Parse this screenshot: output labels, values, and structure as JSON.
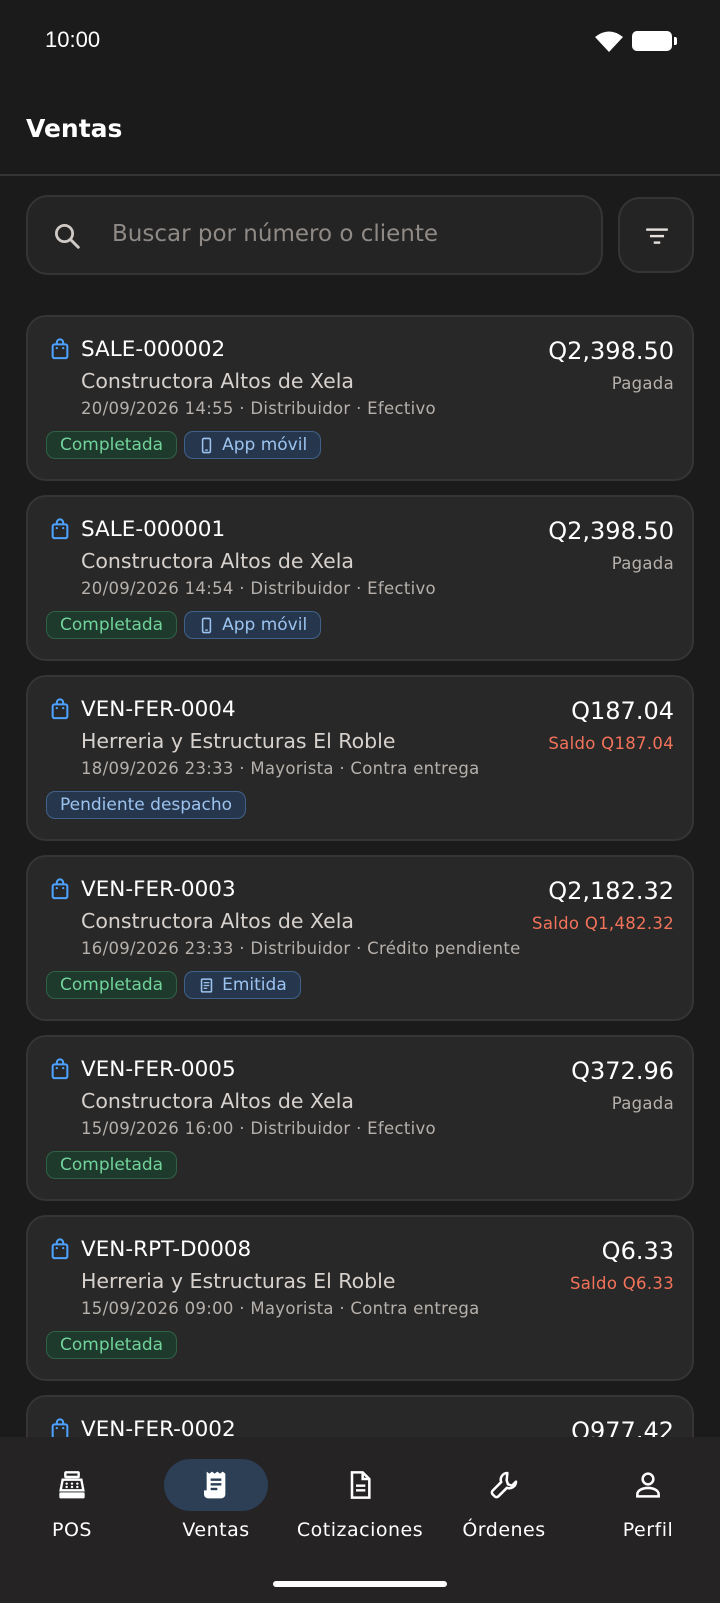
{
  "status_bar": {
    "time": "10:00"
  },
  "app_bar": {
    "title": "Ventas"
  },
  "search": {
    "placeholder": "Buscar por número o cliente"
  },
  "colors": {
    "accent": "#4da3ff",
    "paid": "#b5b0ab",
    "balance_due": "#f2735a",
    "chip_green": "#72d29b",
    "chip_blue": "#9cc3ef"
  },
  "sales": [
    {
      "number": "SALE-000002",
      "customer": "Constructora Altos de Xela",
      "meta": "20/09/2026 14:55 · Distribuidor · Efectivo",
      "amount": "Q2,398.50",
      "balance": "Pagada",
      "balance_due": false,
      "chips": [
        {
          "label": "Completada",
          "style": "green",
          "icon": ""
        },
        {
          "label": "App móvil",
          "style": "blue",
          "icon": "phone-icon"
        }
      ]
    },
    {
      "number": "SALE-000001",
      "customer": "Constructora Altos de Xela",
      "meta": "20/09/2026 14:54 · Distribuidor · Efectivo",
      "amount": "Q2,398.50",
      "balance": "Pagada",
      "balance_due": false,
      "chips": [
        {
          "label": "Completada",
          "style": "green",
          "icon": ""
        },
        {
          "label": "App móvil",
          "style": "blue",
          "icon": "phone-icon"
        }
      ]
    },
    {
      "number": "VEN-FER-0004",
      "customer": "Herreria y Estructuras El Roble",
      "meta": "18/09/2026 23:33 · Mayorista · Contra entrega",
      "amount": "Q187.04",
      "balance": "Saldo Q187.04",
      "balance_due": true,
      "chips": [
        {
          "label": "Pendiente despacho",
          "style": "blue",
          "icon": ""
        }
      ]
    },
    {
      "number": "VEN-FER-0003",
      "customer": "Constructora Altos de Xela",
      "meta": "16/09/2026 23:33 · Distribuidor · Crédito pendiente",
      "amount": "Q2,182.32",
      "balance": "Saldo Q1,482.32",
      "balance_due": true,
      "chips": [
        {
          "label": "Completada",
          "style": "green",
          "icon": ""
        },
        {
          "label": "Emitida",
          "style": "blue",
          "icon": "receipt-icon"
        }
      ]
    },
    {
      "number": "VEN-FER-0005",
      "customer": "Constructora Altos de Xela",
      "meta": "15/09/2026 16:00 · Distribuidor · Efectivo",
      "amount": "Q372.96",
      "balance": "Pagada",
      "balance_due": false,
      "chips": [
        {
          "label": "Completada",
          "style": "green",
          "icon": ""
        }
      ]
    },
    {
      "number": "VEN-RPT-D0008",
      "customer": "Herreria y Estructuras El Roble",
      "meta": "15/09/2026 09:00 · Mayorista · Contra entrega",
      "amount": "Q6.33",
      "balance": "Saldo Q6.33",
      "balance_due": true,
      "chips": [
        {
          "label": "Completada",
          "style": "green",
          "icon": ""
        }
      ]
    },
    {
      "number": "VEN-FER-0002",
      "customer": "",
      "meta": "",
      "amount": "Q977.42",
      "balance": "",
      "balance_due": false,
      "chips": []
    }
  ],
  "bottom_nav": [
    {
      "label": "POS",
      "icon": "cash-register-icon",
      "active": false
    },
    {
      "label": "Ventas",
      "icon": "receipt-long-icon",
      "active": true
    },
    {
      "label": "Cotizaciones",
      "icon": "document-icon",
      "active": false
    },
    {
      "label": "Órdenes",
      "icon": "wrench-icon",
      "active": false
    },
    {
      "label": "Perfil",
      "icon": "person-icon",
      "active": false
    }
  ]
}
